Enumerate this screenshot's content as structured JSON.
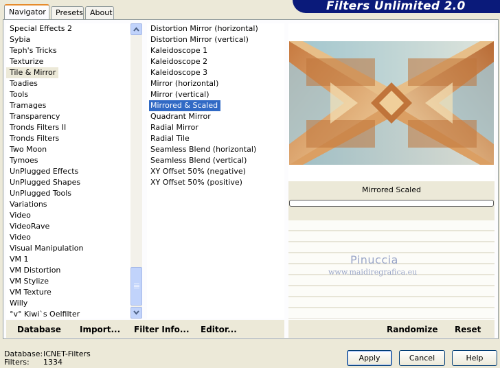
{
  "app": {
    "title": "Filters Unlimited 2.0"
  },
  "tabs": [
    {
      "label": "Navigator",
      "active": true
    },
    {
      "label": "Presets",
      "active": false
    },
    {
      "label": "About",
      "active": false
    }
  ],
  "categories": {
    "items": [
      "Special Effects 2",
      "Sybia",
      "Teph's Tricks",
      "Texturize",
      "Tile & Mirror",
      "Toadies",
      "Tools",
      "Tramages",
      "Transparency",
      "Tronds Filters II",
      "Tronds Filters",
      "Two Moon",
      "Tymoes",
      "UnPlugged Effects",
      "UnPlugged Shapes",
      "UnPlugged Tools",
      "Variations",
      "Video",
      "VideoRave",
      "Video",
      "Visual Manipulation",
      "VM 1",
      "VM Distortion",
      "VM Stylize",
      "VM Texture",
      "Willy",
      "°v° Kiwi`s Oelfilter"
    ],
    "selected": "Tile & Mirror"
  },
  "filters": {
    "items": [
      "Distortion Mirror (horizontal)",
      "Distortion Mirror (vertical)",
      "Kaleidoscope 1",
      "Kaleidoscope 2",
      "Kaleidoscope 3",
      "Mirror (horizontal)",
      "Mirror (vertical)",
      "Mirrored & Scaled",
      "Quadrant Mirror",
      "Radial Mirror",
      "Radial Tile",
      "Seamless Blend (horizontal)",
      "Seamless Blend (vertical)",
      "XY Offset 50% (negative)",
      "XY Offset 50% (positive)"
    ],
    "selected": "Mirrored & Scaled"
  },
  "preview": {
    "filter_name": "Mirrored  Scaled"
  },
  "watermark": {
    "name": "Pinuccia",
    "url": "www.maidiregrafica.eu"
  },
  "toolbar": {
    "database": "Database",
    "import": "Import...",
    "filter_info": "Filter Info...",
    "editor": "Editor...",
    "randomize": "Randomize",
    "reset": "Reset"
  },
  "status": {
    "database_label": "Database:",
    "database_value": "ICNET-Filters",
    "filters_label": "Filters:",
    "filters_value": "1334"
  },
  "buttons": {
    "apply": "Apply",
    "cancel": "Cancel",
    "help": "Help"
  },
  "colors": {
    "banner": "#0a1a7a",
    "selection": "#316ac5",
    "tab_accent": "#e68b2c"
  }
}
